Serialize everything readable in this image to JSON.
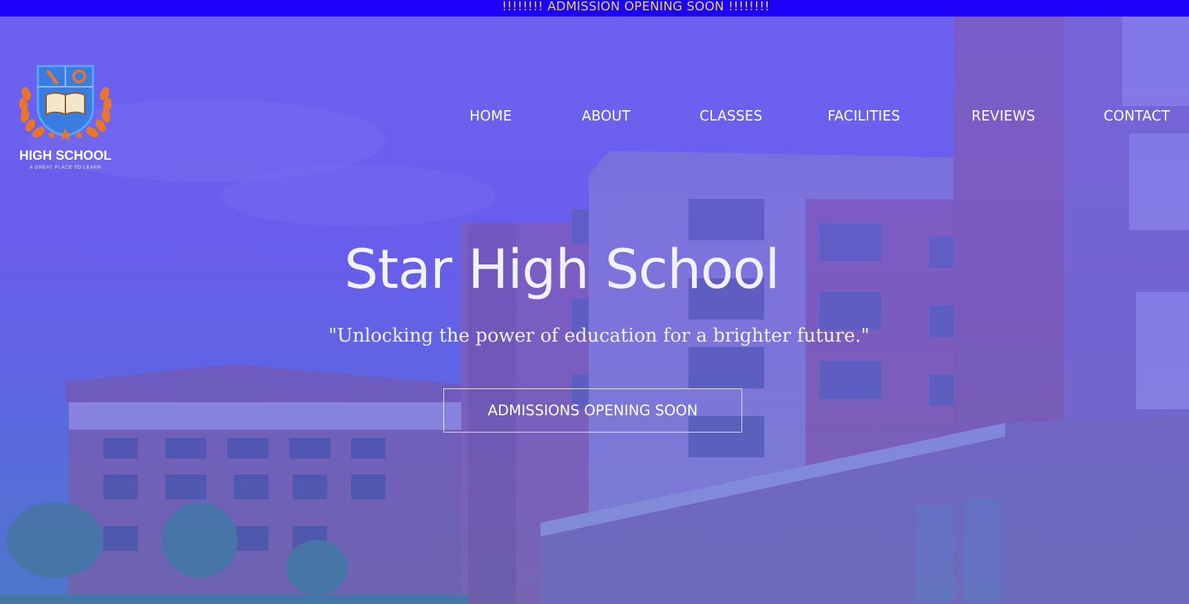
{
  "banner": {
    "text": "!!!!!!!! ADMISSION OPENING SOON !!!!!!!!"
  },
  "logo": {
    "title": "HIGH SCHOOL",
    "tagline": "A GREAT PLACE TO LEARN"
  },
  "nav": {
    "items": [
      "HOME",
      "ABOUT",
      "CLASSES",
      "FACILITIES",
      "REVIEWS",
      "CONTACT"
    ]
  },
  "hero": {
    "title": "Star High School",
    "subtitle": "\"Unlocking the power of education for a brighter future.\"",
    "button_label": "ADMISSIONS OPENING SOON"
  },
  "colors": {
    "banner_bg": "#1c00f8",
    "banner_text": "#e5d46a",
    "overlay": "#6d63ea",
    "text": "#ffffff"
  }
}
